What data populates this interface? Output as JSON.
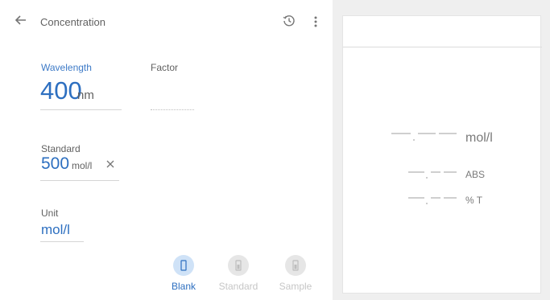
{
  "header": {
    "title": "Concentration"
  },
  "wavelength": {
    "label": "Wavelength",
    "value": "400",
    "unit": "nm"
  },
  "factor": {
    "label": "Factor"
  },
  "standard": {
    "label": "Standard",
    "value": "500",
    "unit": "mol/l"
  },
  "unit": {
    "label": "Unit",
    "value": "mol/l"
  },
  "modes": [
    {
      "label": "Blank",
      "active": true
    },
    {
      "label": "Standard",
      "active": false
    },
    {
      "label": "Sample",
      "active": false
    }
  ],
  "results": {
    "concentration_unit": "mol/l",
    "abs_unit": "ABS",
    "transmittance_unit": "% T"
  },
  "colors": {
    "accent": "#2d6fc0",
    "active_circle": "#cfe2f7",
    "inactive_circle": "#e6e6e6",
    "inactive_text": "#c6c6c6",
    "panel_background": "#efefef"
  },
  "icons": {
    "back": "arrow-left-icon",
    "history": "history-icon",
    "more": "more-vert-icon",
    "clear": "close-icon",
    "cuvette": "cuvette-icon"
  }
}
